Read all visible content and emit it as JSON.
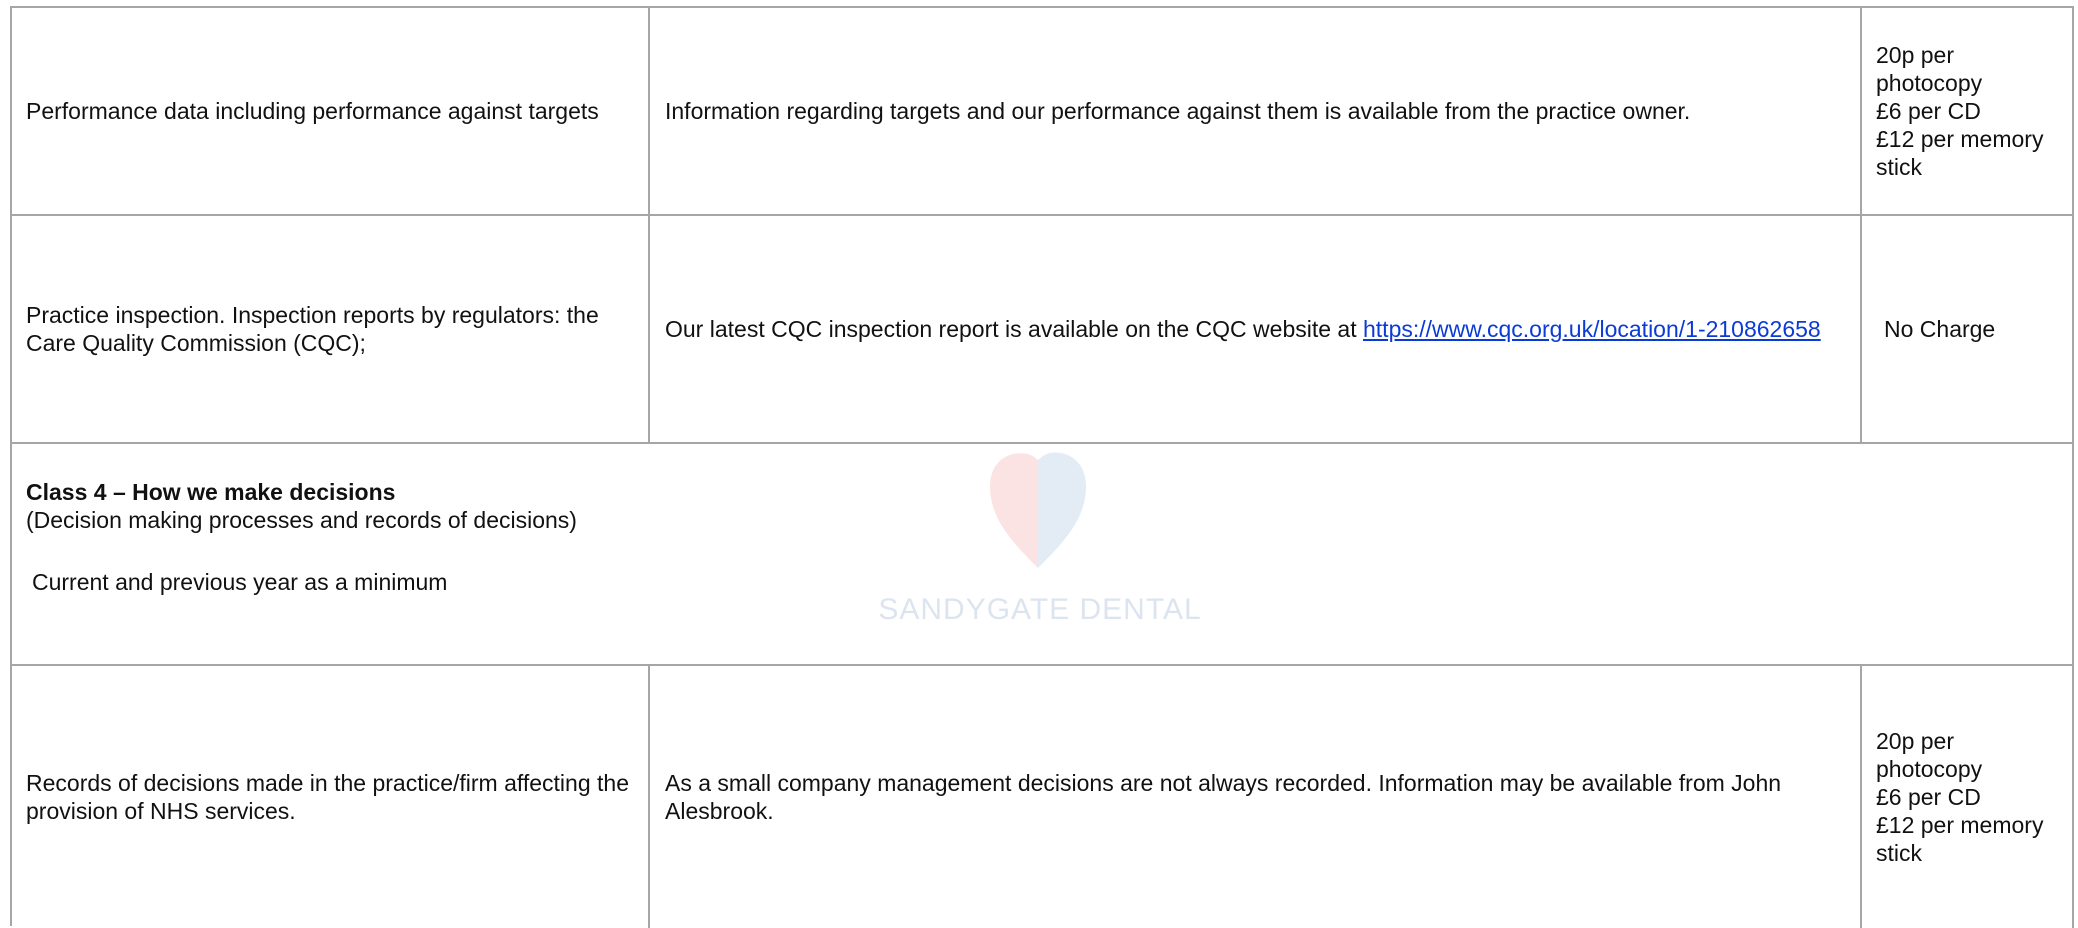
{
  "rows": [
    {
      "description": "Performance data including performance against targets",
      "details": "Information regarding targets and our performance against them is available from the practice owner.",
      "charge_lines": [
        "20p per photocopy",
        "£6 per CD",
        "£12 per memory stick"
      ]
    },
    {
      "description": "Practice inspection. Inspection reports by regulators: the Care Quality Commission (CQC);",
      "details_prefix": "Our latest CQC inspection report is available on the CQC website at ",
      "details_link": "https://www.cqc.org.uk/location/1-210862658",
      "charge": "No Charge"
    },
    {
      "title": "Class 4 – How we make decisions",
      "subtitle": "(Decision making processes and records of decisions)",
      "note": "Current and previous year as a minimum"
    },
    {
      "description": "Records of decisions made in the practice/firm affecting the provision of NHS services.",
      "details": "As a small company management decisions are not always recorded. Information may be available from John Alesbrook.",
      "charge_lines": [
        "20p per photocopy",
        "£6 per CD",
        "£12 per memory stick"
      ]
    }
  ],
  "watermark": {
    "text": "SANDYGATE DENTAL",
    "icon": "heart-icon",
    "colors": {
      "left": "#fbe3e3",
      "right": "#e3ecf5"
    }
  }
}
